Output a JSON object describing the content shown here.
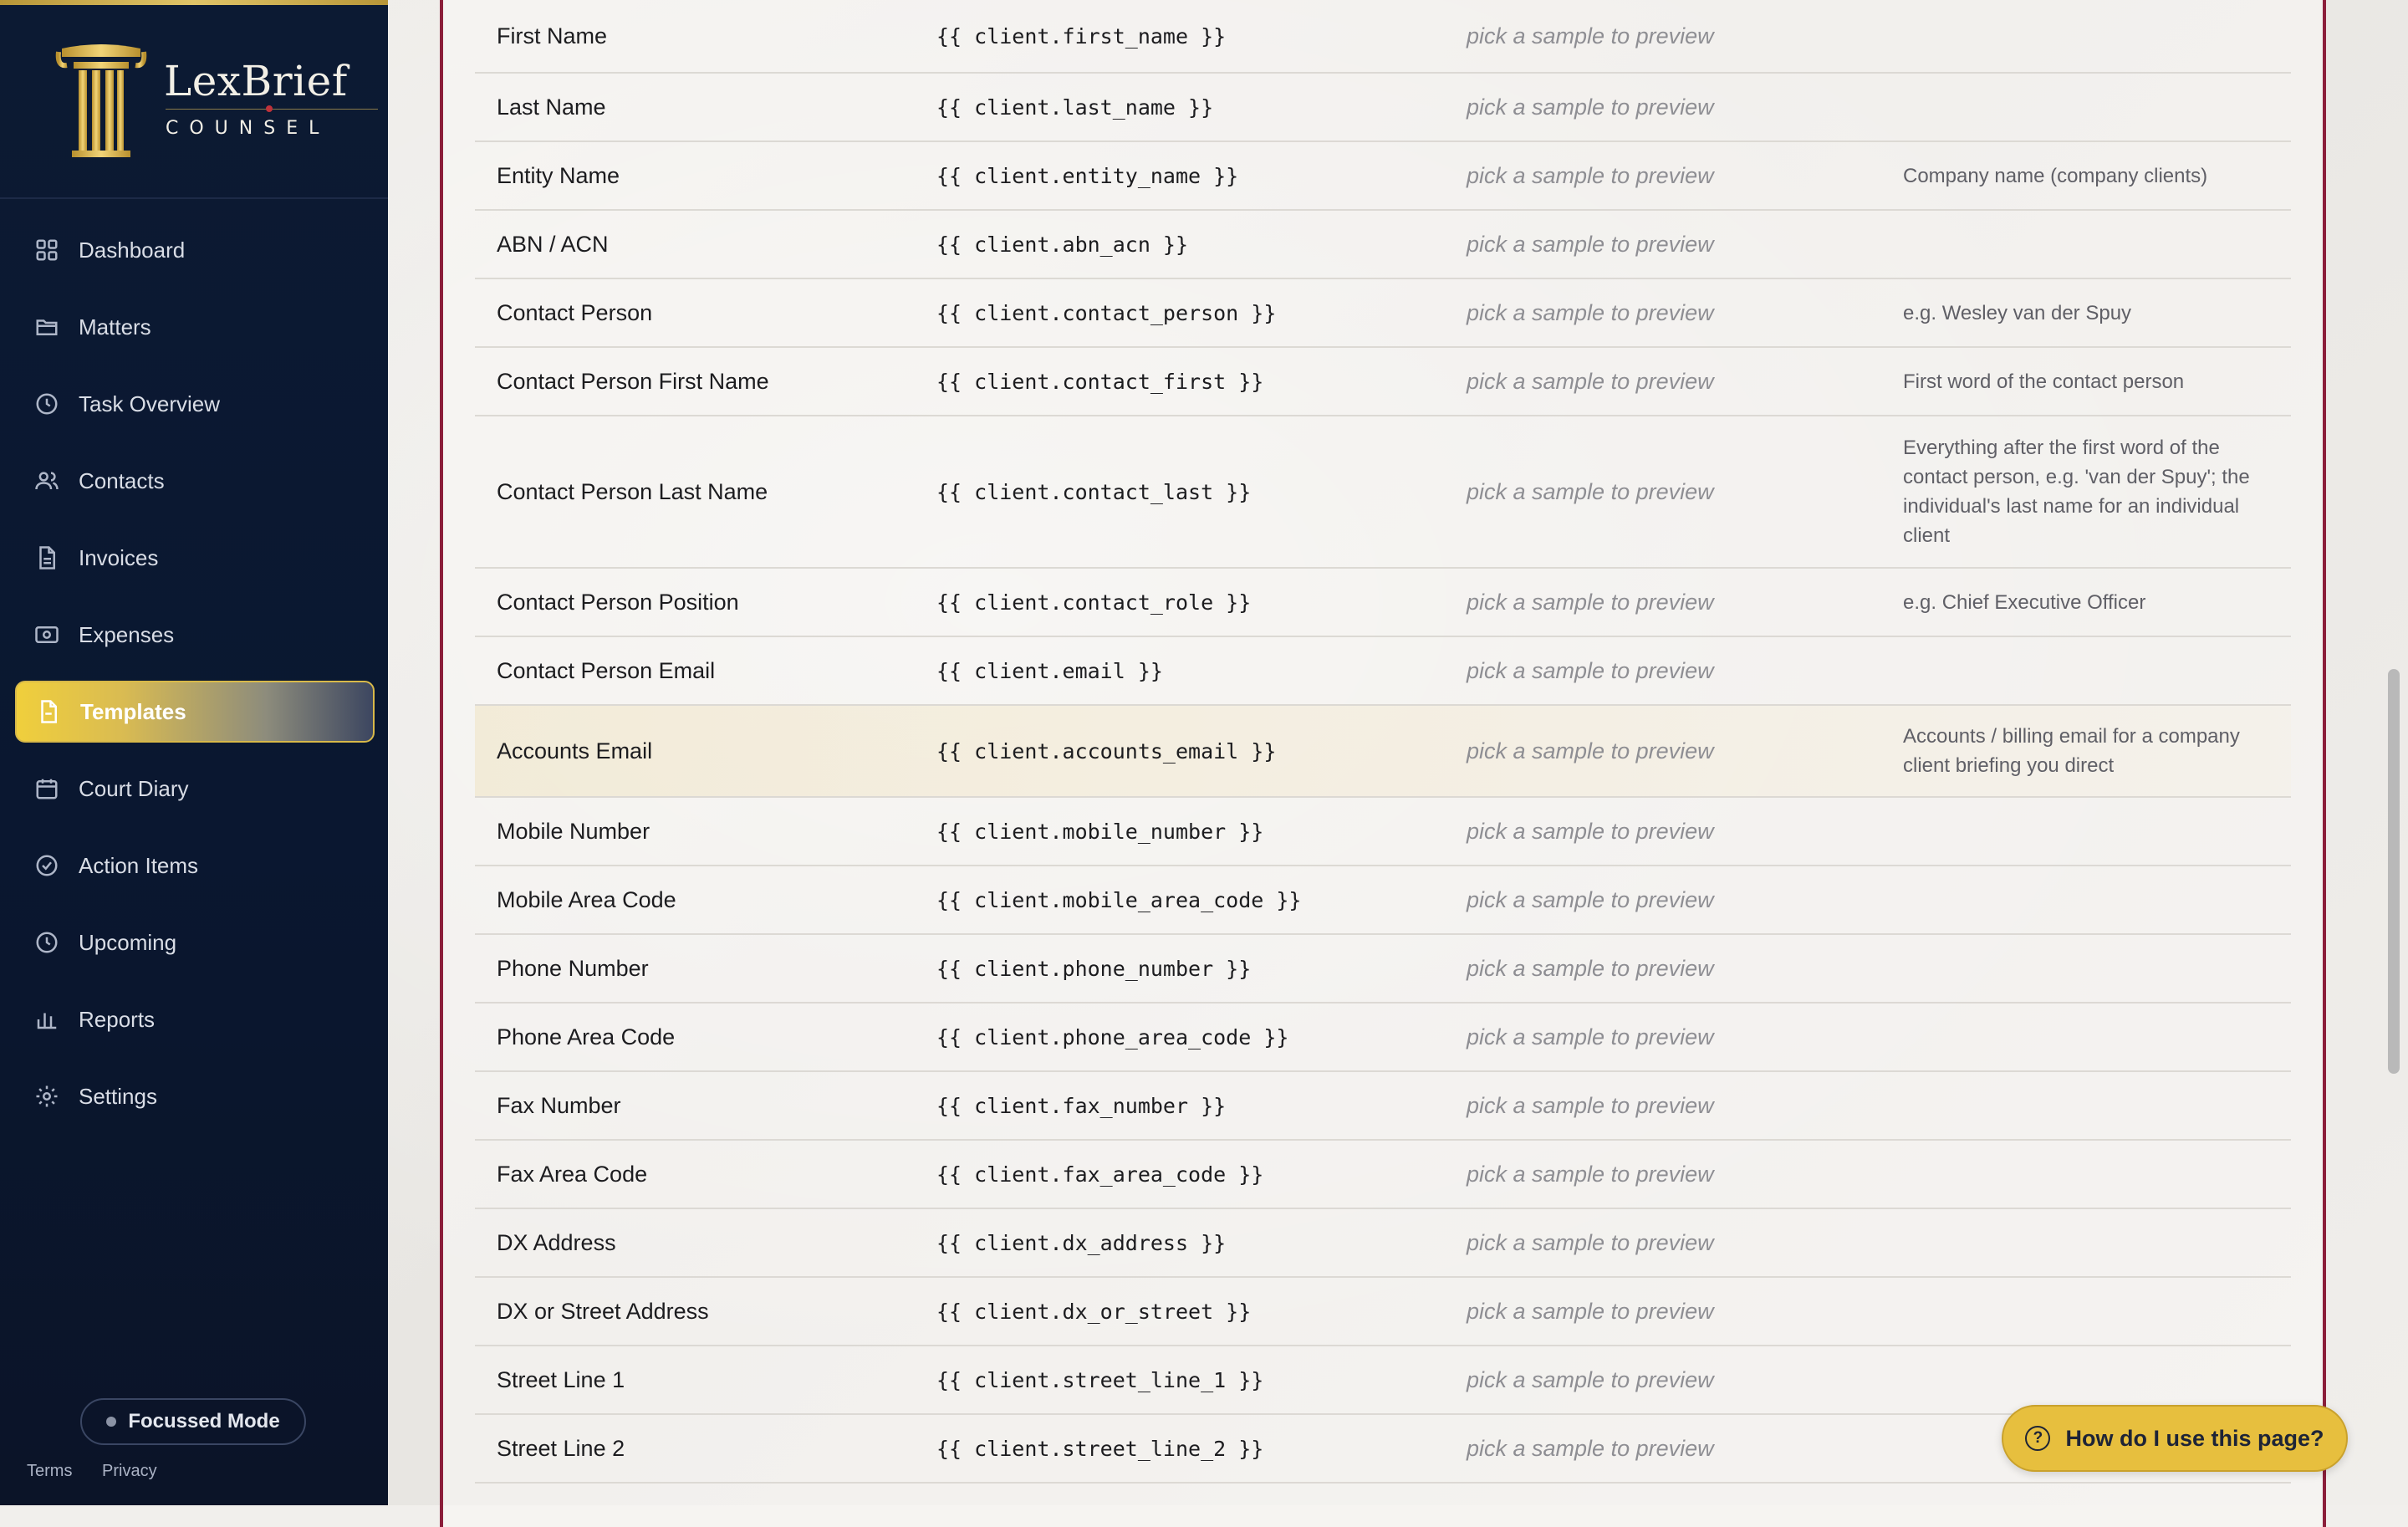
{
  "brand": {
    "name": "LexBrief",
    "subtitle": "COUNSEL"
  },
  "nav": [
    {
      "label": "Dashboard",
      "icon": "dashboard-icon"
    },
    {
      "label": "Matters",
      "icon": "folder-icon"
    },
    {
      "label": "Task Overview",
      "icon": "clock-icon"
    },
    {
      "label": "Contacts",
      "icon": "users-icon"
    },
    {
      "label": "Invoices",
      "icon": "file-text-icon"
    },
    {
      "label": "Expenses",
      "icon": "banknote-icon"
    },
    {
      "label": "Templates",
      "icon": "file-icon",
      "active": true
    },
    {
      "label": "Court Diary",
      "icon": "calendar-icon"
    },
    {
      "label": "Action Items",
      "icon": "check-circle-icon"
    },
    {
      "label": "Upcoming",
      "icon": "clock-icon"
    },
    {
      "label": "Reports",
      "icon": "bar-chart-icon"
    },
    {
      "label": "Settings",
      "icon": "gear-icon"
    }
  ],
  "focus_mode": {
    "label": "Focussed Mode"
  },
  "footer": {
    "terms": "Terms",
    "privacy": "Privacy"
  },
  "rows": [
    {
      "name": "First Name",
      "var": "{{ client.first_name }}",
      "preview": "pick a sample to preview",
      "note": ""
    },
    {
      "name": "Last Name",
      "var": "{{ client.last_name }}",
      "preview": "pick a sample to preview",
      "note": ""
    },
    {
      "name": "Entity Name",
      "var": "{{ client.entity_name }}",
      "preview": "pick a sample to preview",
      "note": "Company name (company clients)"
    },
    {
      "name": "ABN / ACN",
      "var": "{{ client.abn_acn }}",
      "preview": "pick a sample to preview",
      "note": ""
    },
    {
      "name": "Contact Person",
      "var": "{{ client.contact_person }}",
      "preview": "pick a sample to preview",
      "note": "e.g. Wesley van der Spuy"
    },
    {
      "name": "Contact Person First Name",
      "var": "{{ client.contact_first }}",
      "preview": "pick a sample to preview",
      "note": "First word of the contact person"
    },
    {
      "name": "Contact Person Last Name",
      "var": "{{ client.contact_last }}",
      "preview": "pick a sample to preview",
      "note": "Everything after the first word of the contact person, e.g. 'van der Spuy'; the individual's last name for an individual client"
    },
    {
      "name": "Contact Person Position",
      "var": "{{ client.contact_role }}",
      "preview": "pick a sample to preview",
      "note": "e.g. Chief Executive Officer"
    },
    {
      "name": "Contact Person Email",
      "var": "{{ client.email }}",
      "preview": "pick a sample to preview",
      "note": ""
    },
    {
      "name": "Accounts Email",
      "var": "{{ client.accounts_email }}",
      "preview": "pick a sample to preview",
      "note": "Accounts / billing email for a company client briefing you direct",
      "highlight": true
    },
    {
      "name": "Mobile Number",
      "var": "{{ client.mobile_number }}",
      "preview": "pick a sample to preview",
      "note": ""
    },
    {
      "name": "Mobile Area Code",
      "var": "{{ client.mobile_area_code }}",
      "preview": "pick a sample to preview",
      "note": ""
    },
    {
      "name": "Phone Number",
      "var": "{{ client.phone_number }}",
      "preview": "pick a sample to preview",
      "note": ""
    },
    {
      "name": "Phone Area Code",
      "var": "{{ client.phone_area_code }}",
      "preview": "pick a sample to preview",
      "note": ""
    },
    {
      "name": "Fax Number",
      "var": "{{ client.fax_number }}",
      "preview": "pick a sample to preview",
      "note": ""
    },
    {
      "name": "Fax Area Code",
      "var": "{{ client.fax_area_code }}",
      "preview": "pick a sample to preview",
      "note": ""
    },
    {
      "name": "DX Address",
      "var": "{{ client.dx_address }}",
      "preview": "pick a sample to preview",
      "note": ""
    },
    {
      "name": "DX or Street Address",
      "var": "{{ client.dx_or_street }}",
      "preview": "pick a sample to preview",
      "note": ""
    },
    {
      "name": "Street Line 1",
      "var": "{{ client.street_line_1 }}",
      "preview": "pick a sample to preview",
      "note": ""
    },
    {
      "name": "Street Line 2",
      "var": "{{ client.street_line_2 }}",
      "preview": "pick a sample to preview",
      "note": ""
    }
  ],
  "help": {
    "label": "How do I use this page?"
  },
  "colors": {
    "accent_gold": "#e7bf3e",
    "panel_border": "#8b1e3a",
    "sidebar_bg": "#0c1a33"
  }
}
